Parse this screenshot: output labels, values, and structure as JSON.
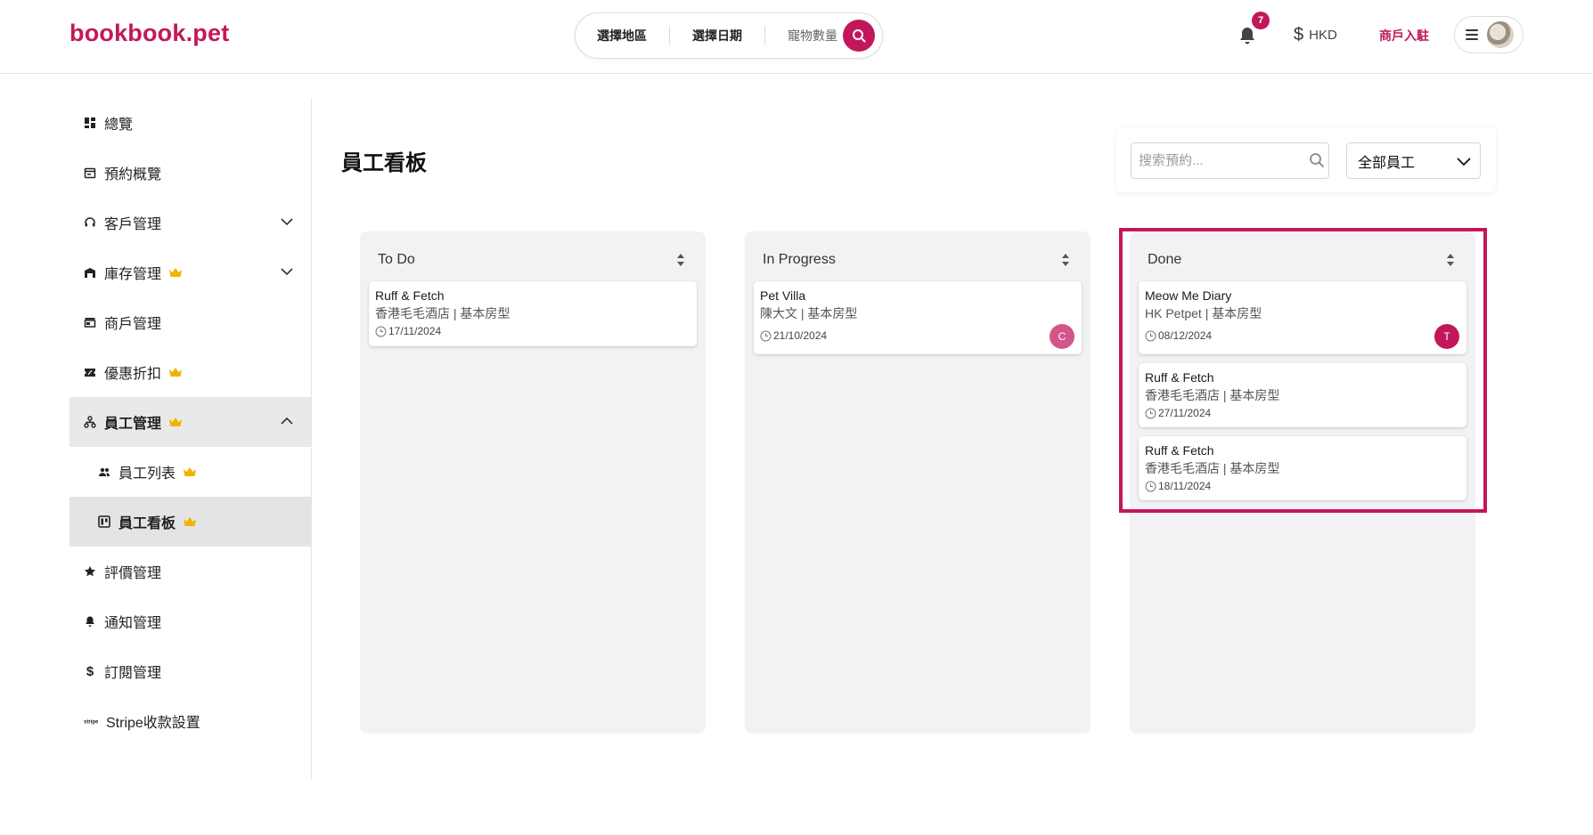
{
  "header": {
    "logo": "bookbook.pet",
    "search": {
      "region_label": "選擇地區",
      "date_label": "選擇日期",
      "pets_label": "寵物數量"
    },
    "notifications_count": "7",
    "currency": "HKD",
    "merchant_link": "商戶入駐"
  },
  "sidebar": {
    "items": [
      {
        "label": "總覽",
        "icon": "dashboard-icon"
      },
      {
        "label": "預約概覽",
        "icon": "calendar-icon"
      },
      {
        "label": "客戶管理",
        "icon": "headset-icon"
      },
      {
        "label": "庫存管理",
        "icon": "warehouse-icon",
        "premium": true
      },
      {
        "label": "商戶管理",
        "icon": "store-icon"
      },
      {
        "label": "優惠折扣",
        "icon": "ticket-icon",
        "premium": true
      },
      {
        "label": "員工管理",
        "icon": "org-chart-icon",
        "premium": true
      },
      {
        "label": "員工列表",
        "icon": "people-icon",
        "premium": true
      },
      {
        "label": "員工看板",
        "icon": "kanban-icon",
        "premium": true
      },
      {
        "label": "評價管理",
        "icon": "star-icon"
      },
      {
        "label": "通知管理",
        "icon": "bell-icon"
      },
      {
        "label": "訂閱管理",
        "icon": "dollar-icon"
      },
      {
        "label": "Stripe收款設置",
        "icon": "stripe-icon"
      }
    ]
  },
  "main": {
    "title": "員工看板",
    "search_placeholder": "搜索預約...",
    "staff_filter": "全部員工",
    "columns": [
      {
        "title": "To Do",
        "cards": [
          {
            "title": "Ruff & Fetch",
            "subtitle": "香港毛毛酒店 | 基本房型",
            "date": "17/11/2024",
            "assignee": ""
          }
        ]
      },
      {
        "title": "In Progress",
        "cards": [
          {
            "title": "Pet Villa",
            "subtitle": "陳大文 | 基本房型",
            "date": "21/10/2024",
            "assignee": "C"
          }
        ]
      },
      {
        "title": "Done",
        "cards": [
          {
            "title": "Meow Me Diary",
            "subtitle": "HK Petpet | 基本房型",
            "date": "08/12/2024",
            "assignee": "T"
          },
          {
            "title": "Ruff & Fetch",
            "subtitle": "香港毛毛酒店 | 基本房型",
            "date": "27/11/2024",
            "assignee": ""
          },
          {
            "title": "Ruff & Fetch",
            "subtitle": "香港毛毛酒店 | 基本房型",
            "date": "18/11/2024",
            "assignee": ""
          }
        ]
      }
    ]
  },
  "colors": {
    "brand": "#c2185b",
    "crown": "#f0b400",
    "column_bg": "#f2f2f4"
  }
}
